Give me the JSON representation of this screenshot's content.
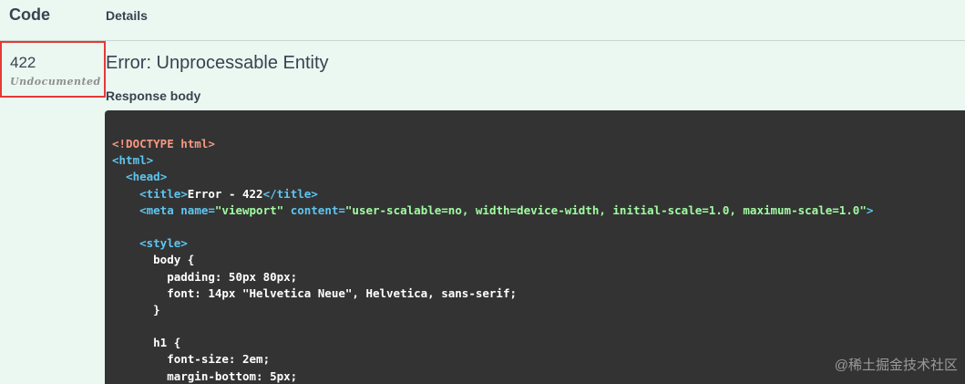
{
  "table": {
    "code_header": "Code",
    "details_header": "Details"
  },
  "response": {
    "status_code": "422",
    "status_note": "Undocumented",
    "title": "Error: Unprocessable Entity",
    "body_label": "Response body",
    "code_lines": [
      [
        {
          "t": "<!DOCTYPE html>",
          "c": "doctype"
        }
      ],
      [
        {
          "t": "<html>",
          "c": "tag"
        }
      ],
      [
        {
          "t": "  ",
          "c": "text"
        },
        {
          "t": "<head>",
          "c": "tag"
        }
      ],
      [
        {
          "t": "    ",
          "c": "text"
        },
        {
          "t": "<title>",
          "c": "tag"
        },
        {
          "t": "Error - 422",
          "c": "text"
        },
        {
          "t": "</title>",
          "c": "tag"
        }
      ],
      [
        {
          "t": "    ",
          "c": "text"
        },
        {
          "t": "<meta ",
          "c": "tag"
        },
        {
          "t": "name=",
          "c": "attr"
        },
        {
          "t": "\"viewport\"",
          "c": "string"
        },
        {
          "t": " content=",
          "c": "attr"
        },
        {
          "t": "\"user-scalable=no, width=device-width, initial-scale=1.0, maximum-scale=1.0\"",
          "c": "string"
        },
        {
          "t": ">",
          "c": "tag"
        }
      ],
      [
        {
          "t": "",
          "c": "text"
        }
      ],
      [
        {
          "t": "    ",
          "c": "text"
        },
        {
          "t": "<style>",
          "c": "tag"
        }
      ],
      [
        {
          "t": "      body {",
          "c": "text"
        }
      ],
      [
        {
          "t": "        padding: 50px 80px;",
          "c": "text"
        }
      ],
      [
        {
          "t": "        font: 14px \"Helvetica Neue\", Helvetica, sans-serif;",
          "c": "text"
        }
      ],
      [
        {
          "t": "      }",
          "c": "text"
        }
      ],
      [
        {
          "t": "",
          "c": "text"
        }
      ],
      [
        {
          "t": "      h1 {",
          "c": "text"
        }
      ],
      [
        {
          "t": "        font-size: 2em;",
          "c": "text"
        }
      ],
      [
        {
          "t": "        margin-bottom: 5px;",
          "c": "text"
        }
      ]
    ]
  },
  "watermark": "@稀土掘金技术社区"
}
